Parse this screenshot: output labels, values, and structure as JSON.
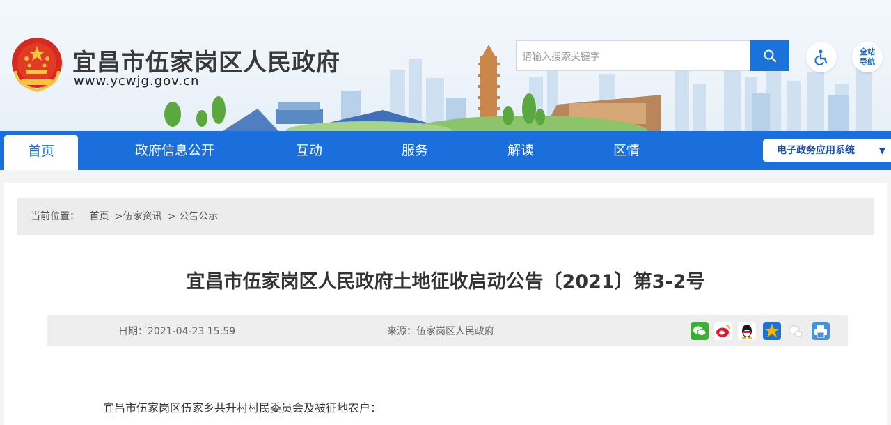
{
  "header": {
    "site_title": "宜昌市伍家岗区人民政府",
    "site_url": "www.ycwjg.gov.cn",
    "search_placeholder": "请输入搜索关键字",
    "nav_site_label_line1": "全站",
    "nav_site_label_line2": "导航"
  },
  "nav": {
    "items": [
      {
        "label": "首页",
        "active": true
      },
      {
        "label": "政府信息公开"
      },
      {
        "label": "互动"
      },
      {
        "label": "服务"
      },
      {
        "label": "解读"
      },
      {
        "label": "区情"
      }
    ],
    "system_dropdown": "电子政务应用系统",
    "dropdown_arrow": "▼"
  },
  "breadcrumb": {
    "prefix": "当前位置：",
    "items": [
      "首页",
      ">伍家资讯",
      "> 公告公示"
    ]
  },
  "article": {
    "title": "宜昌市伍家岗区人民政府土地征收启动公告〔2021〕第3-2号",
    "date": "日期：2021-04-23 15:59",
    "source": "来源：伍家岗区人民政府",
    "body_first_line": "宜昌市伍家岗区伍家乡共升村村民委员会及被征地农户："
  },
  "share_icons": [
    {
      "name": "wechat-share-icon",
      "color": "#3cb034"
    },
    {
      "name": "weibo-share-icon",
      "color": "#e6162d"
    },
    {
      "name": "qq-share-icon",
      "color": "#12b7f5"
    },
    {
      "name": "qzone-share-icon",
      "color": "#f5b400"
    },
    {
      "name": "friend-share-icon",
      "color": "#d8d8d8"
    },
    {
      "name": "print-icon",
      "color": "#4a8fd9"
    }
  ],
  "colors": {
    "nav_blue": "#1a6fdc",
    "search_button": "#1a73d9"
  }
}
